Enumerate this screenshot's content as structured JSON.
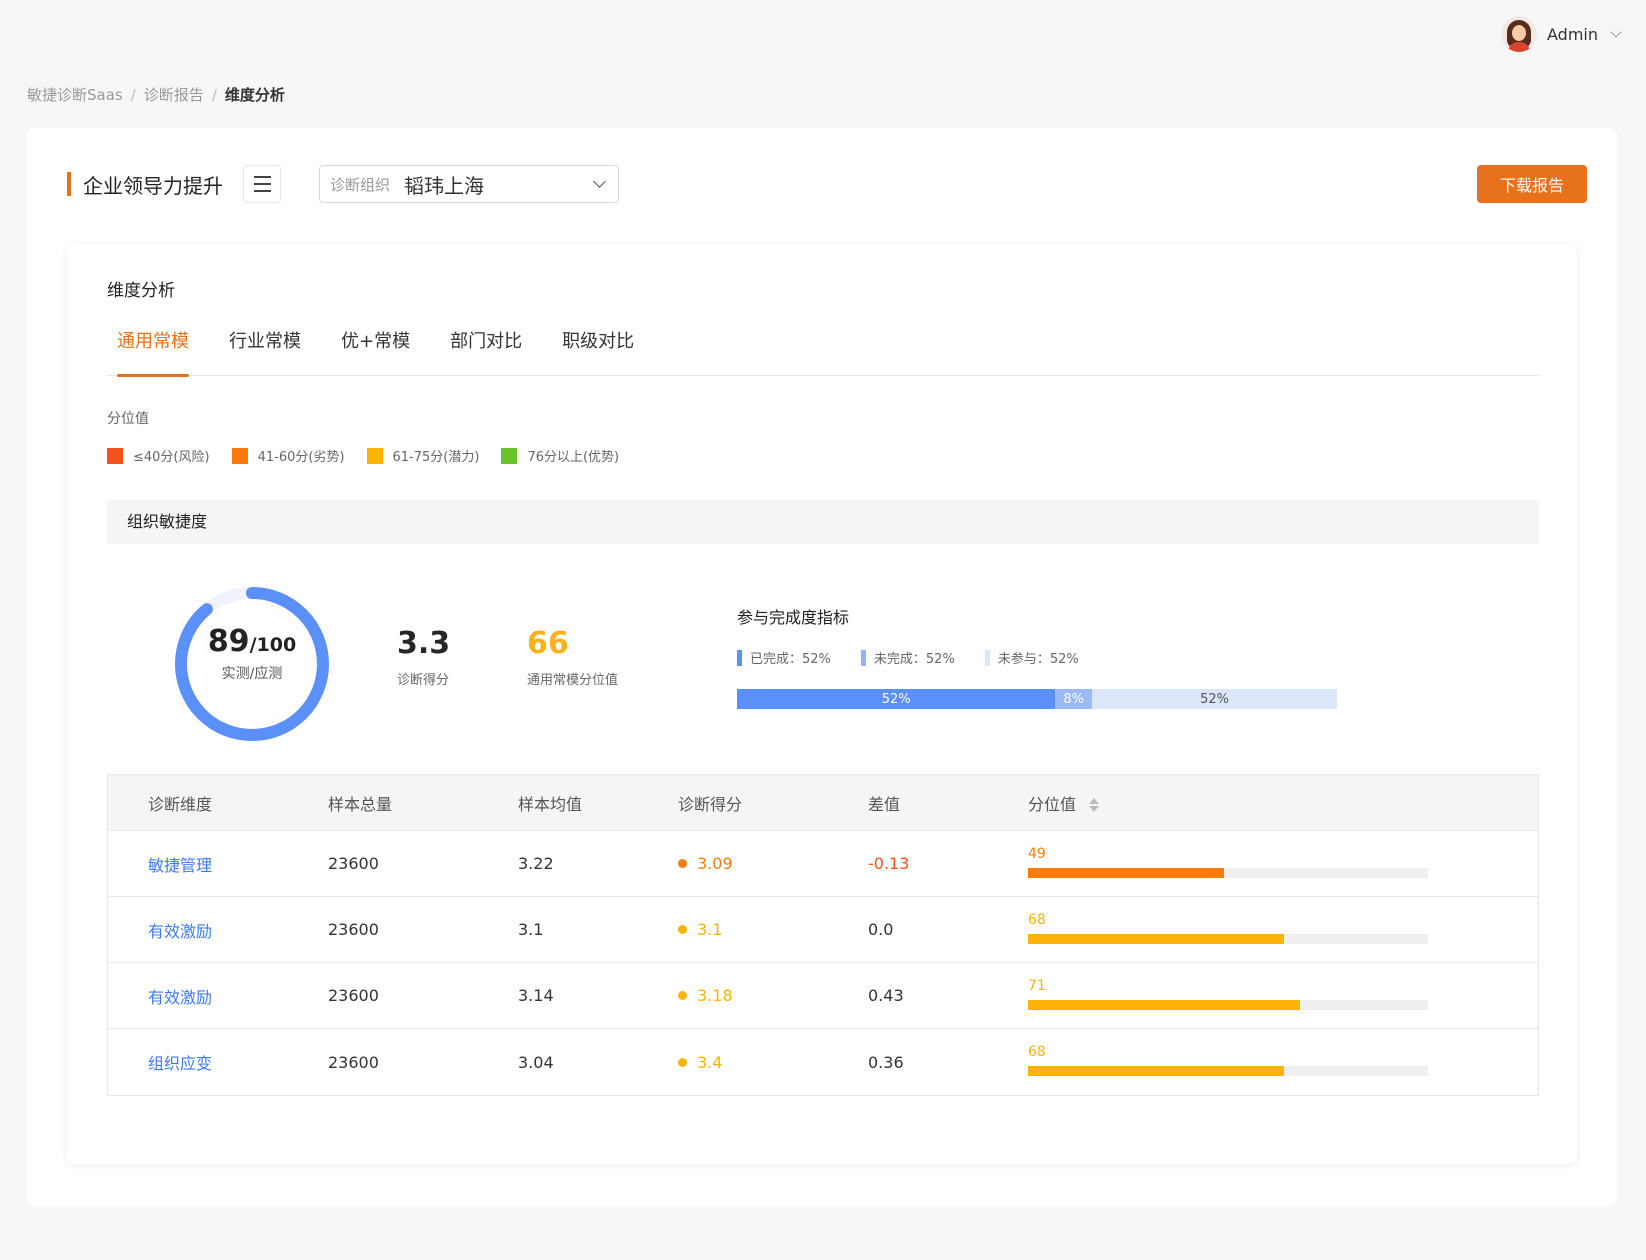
{
  "user": {
    "name": "Admin"
  },
  "breadcrumb": [
    "敏捷诊断Saas",
    "诊断报告",
    "维度分析"
  ],
  "header": {
    "title": "企业领导力提升",
    "org_label": "诊断组织",
    "org_value": "韬玮上海",
    "download_label": "下载报告"
  },
  "section_title": "维度分析",
  "tabs": [
    "通用常模",
    "行业常模",
    "优+常模",
    "部门对比",
    "职级对比"
  ],
  "active_tab": 0,
  "percentile_label": "分位值",
  "legend": [
    {
      "label": "≤40分(风险)",
      "color": "#f4511e"
    },
    {
      "label": "41-60分(劣势)",
      "color": "#fb7a0a"
    },
    {
      "label": "61-75分(潜力)",
      "color": "#ffb20a"
    },
    {
      "label": "76分以上(优势)",
      "color": "#6cc22a"
    }
  ],
  "group_title": "组织敏捷度",
  "donut": {
    "actual": 89,
    "total": "/100",
    "total_value": 100,
    "caption": "实测/应测",
    "color": "#5b8ff9",
    "track": "#eef3fc"
  },
  "stats": [
    {
      "value": "3.3",
      "label": "诊断得分",
      "color": "#222222"
    },
    {
      "value": "66",
      "label": "通用常模分位值",
      "color": "#fbb11a"
    }
  ],
  "participation": {
    "title": "参与完成度指标",
    "legend": [
      {
        "label": "已完成：52%",
        "color": "#5b8ff9"
      },
      {
        "label": "未完成：52%",
        "color": "#93b4f5"
      },
      {
        "label": "未参与：52%",
        "color": "#dbe6fb"
      }
    ],
    "segments": [
      {
        "label": "52%",
        "value": 52,
        "color": "#5b8ff9",
        "text": "#ffffff"
      },
      {
        "label": "8%",
        "value": 6,
        "color": "#9ab9f6",
        "text": "#ffffff"
      },
      {
        "label": "52%",
        "value": 40,
        "color": "#dbe6fb",
        "text": "#555555"
      }
    ]
  },
  "table": {
    "headers": [
      "诊断维度",
      "样本总量",
      "样本均值",
      "诊断得分",
      "差值",
      "分位值"
    ],
    "rows": [
      {
        "dimension": "敏捷管理",
        "total": "23600",
        "mean": "3.22",
        "score": "3.09",
        "score_color": "#fb7a0a",
        "diff": "-0.13",
        "diff_color": "#f4511e",
        "pct": "49",
        "pct_value": 49,
        "bar_color": "#fb7a0a"
      },
      {
        "dimension": "有效激励",
        "total": "23600",
        "mean": "3.1",
        "score": "3.1",
        "score_color": "#ffb20a",
        "diff": "0.0",
        "diff_color": "#333333",
        "pct": "68",
        "pct_value": 64,
        "bar_color": "#ffb20a"
      },
      {
        "dimension": "有效激励",
        "total": "23600",
        "mean": "3.14",
        "score": "3.18",
        "score_color": "#ffb20a",
        "diff": "0.43",
        "diff_color": "#333333",
        "pct": "71",
        "pct_value": 68,
        "bar_color": "#ffb20a"
      },
      {
        "dimension": "组织应变",
        "total": "23600",
        "mean": "3.04",
        "score": "3.4",
        "score_color": "#ffb20a",
        "diff": "0.36",
        "diff_color": "#333333",
        "pct": "68",
        "pct_value": 64,
        "bar_color": "#ffb20a"
      }
    ]
  }
}
